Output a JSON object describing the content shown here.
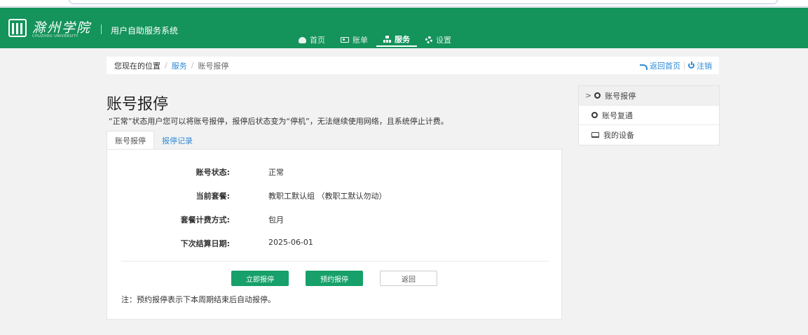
{
  "header": {
    "logo_cn": "滁州学院",
    "logo_en": "CHUZHOU UNIVERSITY",
    "system_name": "用户自助服务系统",
    "nav": [
      {
        "label": "首页",
        "icon": "palette-icon"
      },
      {
        "label": "账单",
        "icon": "card-icon"
      },
      {
        "label": "服务",
        "icon": "sitemap-icon",
        "active": true
      },
      {
        "label": "设置",
        "icon": "gear-icon"
      }
    ]
  },
  "breadcrumb": {
    "prefix": "您现在的位置",
    "link": "服务",
    "current": "账号报停",
    "back_home": "返回首页",
    "logout": "注销"
  },
  "main": {
    "title": "账号报停",
    "description": "“正常”状态用户您可以将账号报停，报停后状态变为“停机”，无法继续使用网络，且系统停止计费。",
    "tabs": [
      {
        "label": "账号报停",
        "active": true
      },
      {
        "label": "报停记录"
      }
    ],
    "fields": [
      {
        "label": "账号状态:",
        "value": "正常"
      },
      {
        "label": "当前套餐:",
        "value": "教职工默认组 （教职工默认勿动）"
      },
      {
        "label": "套餐计费方式:",
        "value": "包月"
      },
      {
        "label": "下次结算日期:",
        "value": "2025-06-01"
      }
    ],
    "buttons": {
      "stop_now": "立即报停",
      "schedule_stop": "预约报停",
      "back": "返回"
    },
    "note": "注：预约报停表示下本周期结束后自动报停。"
  },
  "sidebar": {
    "items": [
      {
        "label": "账号报停",
        "active": true,
        "marker": ">"
      },
      {
        "label": "账号复通"
      },
      {
        "label": "我的设备"
      }
    ]
  },
  "colors": {
    "header_green": "#14935b",
    "button_green": "#17a06a",
    "link_blue": "#2d8ad8"
  }
}
